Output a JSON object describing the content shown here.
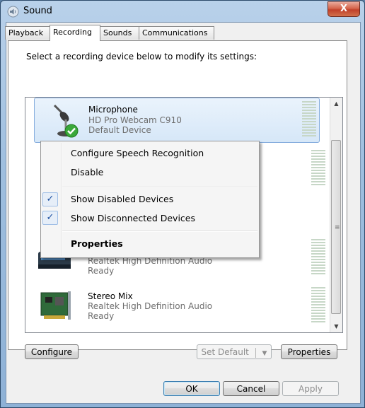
{
  "window": {
    "title": "Sound",
    "close_label": "X"
  },
  "tabs": [
    "Playback",
    "Recording",
    "Sounds",
    "Communications"
  ],
  "active_tab": "Recording",
  "instruction": "Select a recording device below to modify its settings:",
  "devices": [
    {
      "name": "Microphone",
      "line1": "HD Pro Webcam C910",
      "line2": "Default Device",
      "icon": "microphone-icon",
      "status_icon": "green-check-icon"
    },
    {
      "name": "",
      "line1": "Realtek High Definition Audio",
      "line2": "Ready",
      "icon": "soundcard-icon"
    },
    {
      "name": "Stereo Mix",
      "line1": "Realtek High Definition Audio",
      "line2": "Ready",
      "icon": "pci-card-icon"
    }
  ],
  "context_menu": {
    "items": [
      {
        "label": "Configure Speech Recognition",
        "checked": false
      },
      {
        "label": "Disable",
        "checked": false
      },
      {
        "label": "Show Disabled Devices",
        "checked": true
      },
      {
        "label": "Show Disconnected Devices",
        "checked": true
      },
      {
        "label": "Properties",
        "checked": false,
        "bold": true
      }
    ]
  },
  "buttons": {
    "configure": "Configure",
    "set_default": "Set Default",
    "properties": "Properties",
    "ok": "OK",
    "cancel": "Cancel",
    "apply": "Apply"
  },
  "colors": {
    "close_red": "#c0402a",
    "selection_border": "#84acdd",
    "check_blue": "#1c4fa0"
  }
}
